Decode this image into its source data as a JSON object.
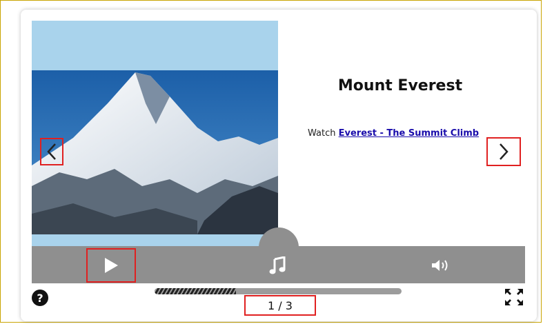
{
  "slide": {
    "title": "Mount Everest",
    "caption_prefix": "Watch",
    "link_text": "Everest - The Summit Climb",
    "image_subject": "snow-capped mountain peak",
    "counter": "1 / 3"
  },
  "controls": {
    "prev_icon": "chevron-left-icon",
    "next_icon": "chevron-right-icon",
    "play_icon": "play-icon",
    "music_icon": "music-note-icon",
    "volume_icon": "volume-icon",
    "help_label": "?",
    "fullscreen_icon": "fullscreen-icon",
    "progress_fraction": 0.33
  },
  "colors": {
    "sky": "#a9d3ec",
    "controls_bar": "#8f8f8f",
    "link": "#1a0dab",
    "highlight": "#e02020"
  }
}
